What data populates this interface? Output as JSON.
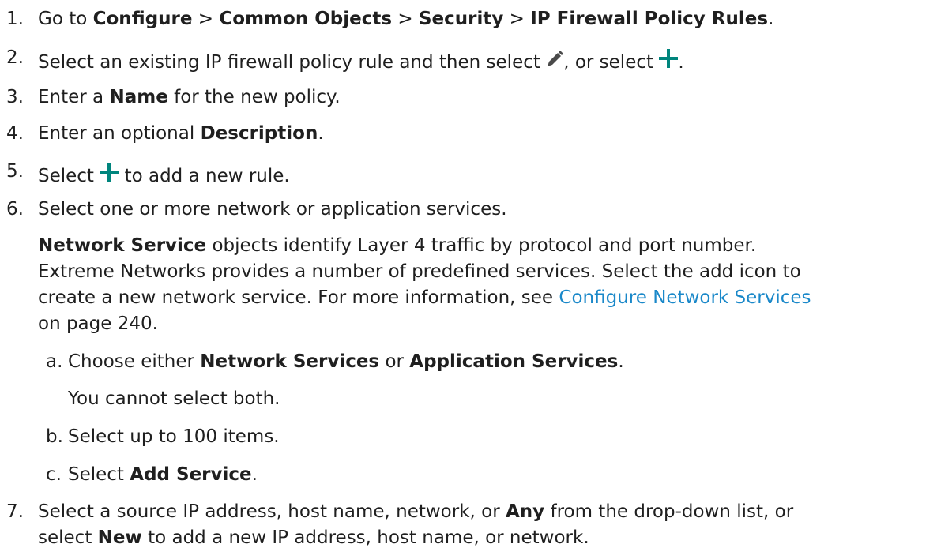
{
  "steps": [
    {
      "number": "1.",
      "parts": [
        "Go to ",
        "Configure",
        " > ",
        "Common Objects",
        " > ",
        "Security",
        " > ",
        "IP Firewall Policy Rules",
        "."
      ]
    },
    {
      "number": "2.",
      "parts": [
        "Select an existing IP firewall policy rule and then select ",
        ", or select ",
        "."
      ],
      "icons": [
        "pencil-icon",
        "plus-icon"
      ]
    },
    {
      "number": "3.",
      "parts": [
        "Enter a ",
        "Name",
        " for the new policy."
      ]
    },
    {
      "number": "4.",
      "parts": [
        "Enter an optional ",
        "Description",
        "."
      ]
    },
    {
      "number": "5.",
      "parts": [
        "Select ",
        " to add a new rule."
      ],
      "icons": [
        "plus-icon"
      ]
    },
    {
      "number": "6.",
      "parts": [
        "Select one or more network or application services."
      ]
    },
    {
      "number": "7.",
      "parts": [
        "Select a source IP address, host name, network, or ",
        "Any",
        " from the drop-down list, or",
        "select ",
        "New",
        " to add a new IP address, host name, or network."
      ]
    }
  ],
  "step6_para": {
    "lead_bold": "Network Service",
    "line1_rest": " objects identify Layer 4 traffic by protocol and port number.",
    "line2": "Extreme Networks provides a number of predefined services. Select the add icon to",
    "line3_pre": "create a new network service. For more information, see ",
    "link_text": "Configure Network Services",
    "line4": "on page 240."
  },
  "substeps": [
    {
      "letter": "a.",
      "parts": [
        "Choose either ",
        "Network Services",
        " or ",
        "Application Services",
        "."
      ],
      "note": "You cannot select both."
    },
    {
      "letter": "b.",
      "parts": [
        "Select up to 100 items."
      ]
    },
    {
      "letter": "c.",
      "parts": [
        "Select ",
        "Add Service",
        "."
      ]
    }
  ],
  "colors": {
    "text": "#1f1f1f",
    "link": "#1a88c9",
    "plus_icon": "#00857d",
    "pencil_icon": "#4a4a4a"
  }
}
